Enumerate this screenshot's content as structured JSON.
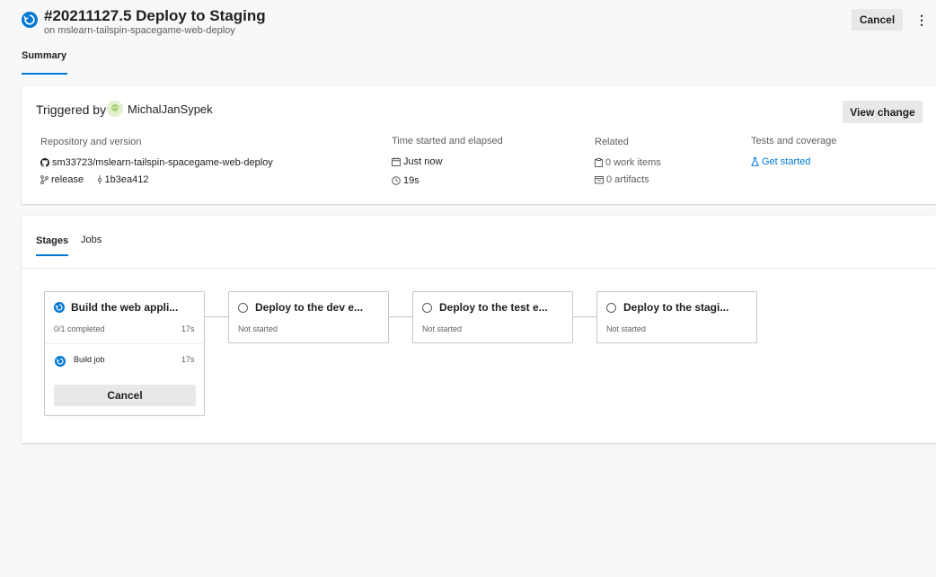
{
  "header": {
    "run_title": "#20211127.5 Deploy to Staging",
    "run_subtitle": "on mslearn-tailspin-spacegame-web-deploy",
    "cancel_label": "Cancel",
    "more_label": "⋮",
    "tab_summary": "Summary"
  },
  "summary": {
    "triggered_by_label": "Triggered by",
    "user": "MichalJanSypek",
    "view_change_label": "View change",
    "repo_heading": "Repository and version",
    "repo_name": "sm33723/mslearn-tailspin-spacegame-web-deploy",
    "branch": "release",
    "commit": "1b3ea412",
    "time_heading": "Time started and elapsed",
    "started": "Just now",
    "elapsed": "19s",
    "related_heading": "Related",
    "work_items": "0 work items",
    "artifacts": "0 artifacts",
    "tests_heading": "Tests and coverage",
    "get_started": "Get started"
  },
  "stages_panel": {
    "tabs": [
      "Stages",
      "Jobs"
    ],
    "stages": [
      {
        "title": "Build the web appli...",
        "status": "0/1 completed",
        "duration": "17s",
        "state": "running",
        "jobs": [
          {
            "name": "Build job",
            "duration": "17s"
          }
        ],
        "cancel_label": "Cancel"
      },
      {
        "title": "Deploy to the dev e...",
        "status": "Not started",
        "state": "not-started"
      },
      {
        "title": "Deploy to the test e...",
        "status": "Not started",
        "state": "not-started"
      },
      {
        "title": "Deploy to the stagi...",
        "status": "Not started",
        "state": "not-started"
      }
    ]
  },
  "colors": {
    "accent": "#0078d4",
    "page_bg": "#f8f8f8",
    "card_bg": "#ffffff",
    "button_bg": "#e8e8e8"
  }
}
